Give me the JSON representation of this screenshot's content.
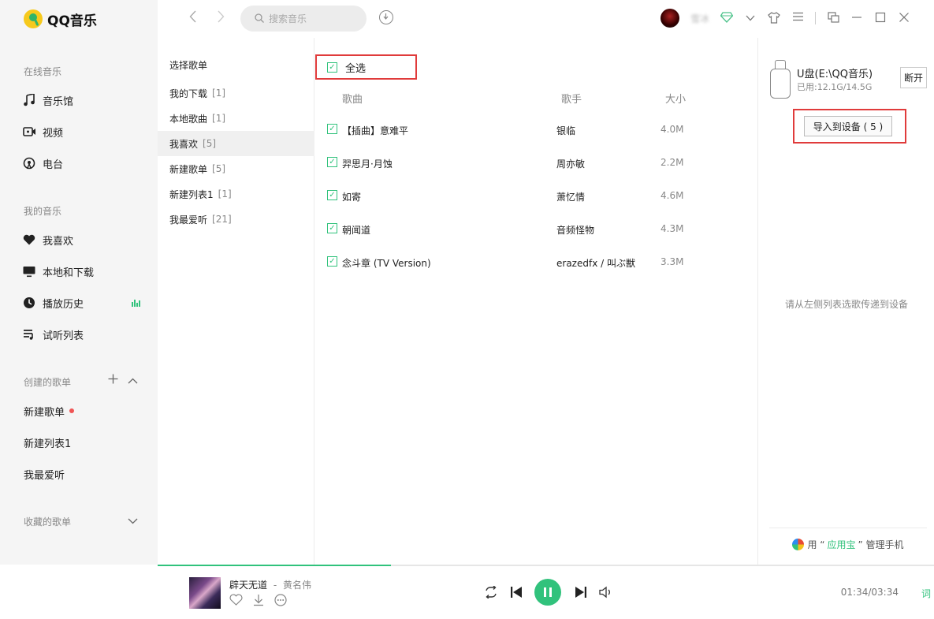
{
  "app": {
    "name": "QQ音乐"
  },
  "sidebar": {
    "online_group": "在线音乐",
    "online_items": [
      {
        "label": "音乐馆",
        "icon": "music-note-icon"
      },
      {
        "label": "视频",
        "icon": "video-icon"
      },
      {
        "label": "电台",
        "icon": "radio-icon"
      }
    ],
    "my_group": "我的音乐",
    "my_items": [
      {
        "label": "我喜欢",
        "icon": "heart-icon"
      },
      {
        "label": "本地和下载",
        "icon": "monitor-icon"
      },
      {
        "label": "播放历史",
        "icon": "clock-icon"
      },
      {
        "label": "试听列表",
        "icon": "playlist-icon"
      }
    ],
    "created_group": "创建的歌单",
    "created_items": [
      {
        "label": "新建歌单"
      },
      {
        "label": "新建列表1"
      },
      {
        "label": "我最爱听"
      }
    ],
    "collected_group": "收藏的歌单",
    "accent": "#31c27c"
  },
  "topbar": {
    "search_placeholder": "搜索音乐",
    "username": "雪冰"
  },
  "playlists": {
    "title": "选择歌单",
    "items": [
      {
        "name": "我的下载",
        "count": "[1]"
      },
      {
        "name": "本地歌曲",
        "count": "[1]"
      },
      {
        "name": "我喜欢",
        "count": "[5]",
        "active": true
      },
      {
        "name": "新建歌单",
        "count": "[5]"
      },
      {
        "name": "新建列表1",
        "count": "[1]"
      },
      {
        "name": "我最爱听",
        "count": "[21]"
      }
    ]
  },
  "songs": {
    "select_all": "全选",
    "columns": {
      "title": "歌曲",
      "artist": "歌手",
      "size": "大小"
    },
    "rows": [
      {
        "title": "【插曲】意难平",
        "artist": "银临",
        "size": "4.0M",
        "checked": true
      },
      {
        "title": "羿思月·月蚀",
        "artist": "周亦敏",
        "size": "2.2M",
        "checked": true
      },
      {
        "title": "如寄",
        "artist": "萧忆情",
        "size": "4.6M",
        "checked": true
      },
      {
        "title": "朝闻道",
        "artist": "音频怪物",
        "size": "4.3M",
        "checked": true
      },
      {
        "title": "念斗章 (TV Version)",
        "artist": "erazedfx / 叫ぶ獣",
        "size": "3.3M",
        "checked": true
      }
    ]
  },
  "device": {
    "name": "U盘(E:\\QQ音乐)",
    "used": "已用:12.1G/14.5G",
    "disconnect": "断开",
    "import": "导入到设备 ( 5 )",
    "hint": "请从左侧列表选歌传递到设备",
    "footer_prefix": "用 “",
    "footer_app": "应用宝",
    "footer_suffix": "” 管理手机"
  },
  "player": {
    "song": "辟天无道",
    "separator": "-",
    "artist": "黄名伟",
    "time": "01:34/03:34",
    "lyric": "词",
    "progress": 0.3
  }
}
